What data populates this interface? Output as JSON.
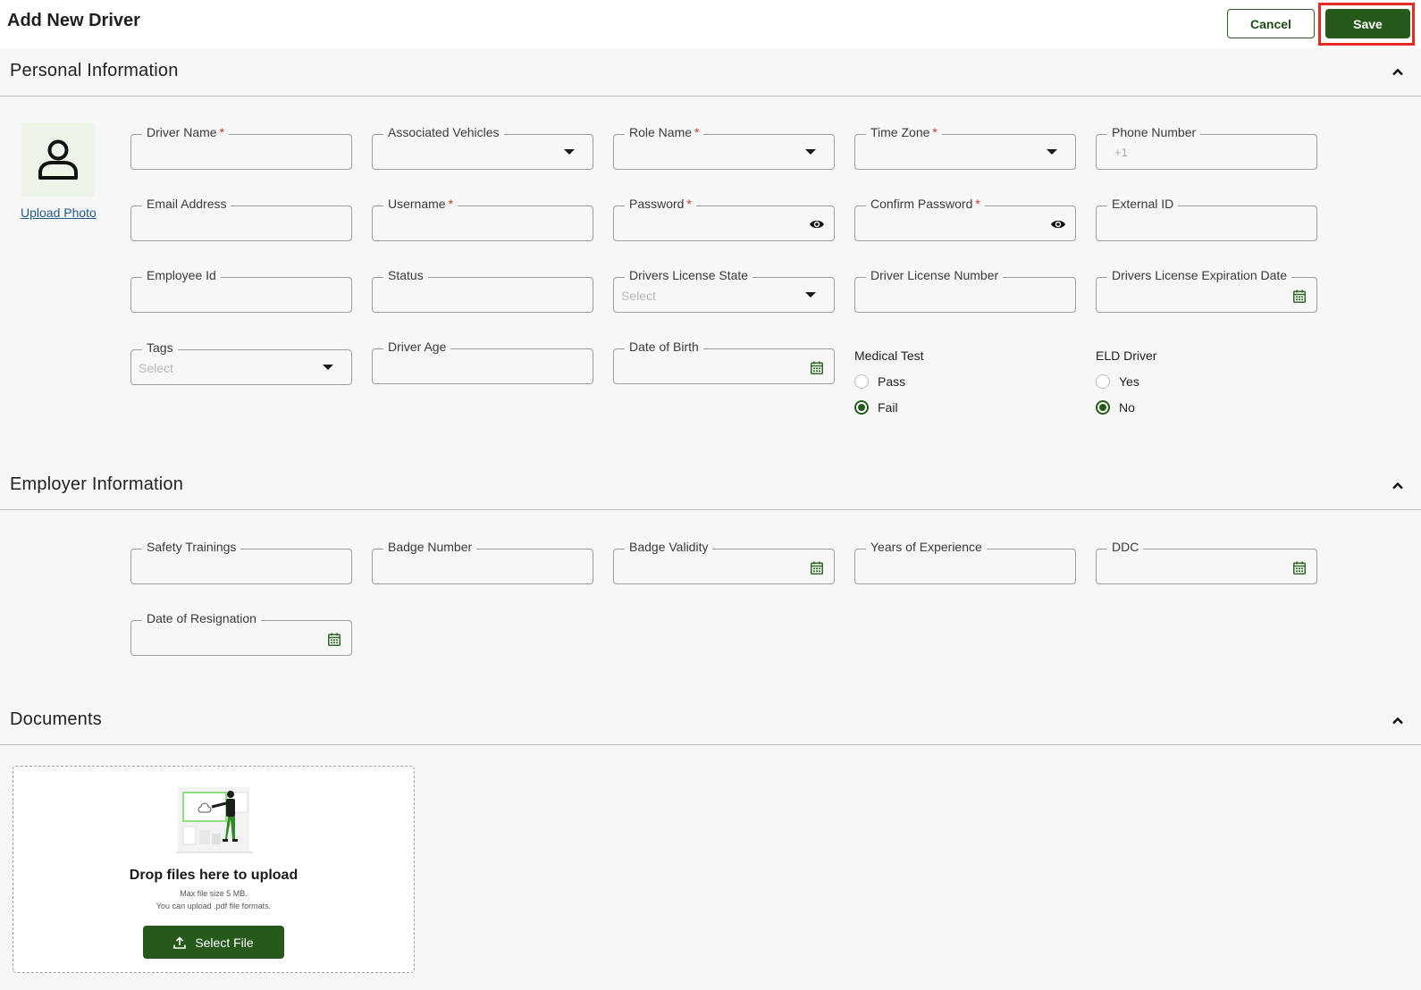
{
  "header": {
    "title": "Add New Driver",
    "cancel_label": "Cancel",
    "save_label": "Save"
  },
  "sections": {
    "personal": "Personal Information",
    "employer": "Employer Information",
    "documents": "Documents"
  },
  "photo": {
    "upload_label": "Upload Photo"
  },
  "personal_fields": {
    "driver_name": {
      "label": "Driver Name",
      "required": "*",
      "value": ""
    },
    "associated_vehicles": {
      "label": "Associated Vehicles",
      "value": ""
    },
    "role_name": {
      "label": "Role Name",
      "required": "*",
      "value": ""
    },
    "time_zone": {
      "label": "Time Zone",
      "required": "*",
      "value": ""
    },
    "phone_number": {
      "label": "Phone Number",
      "country_code": "+1",
      "value": ""
    },
    "email_address": {
      "label": "Email Address",
      "value": ""
    },
    "username": {
      "label": "Username",
      "required": "*",
      "value": ""
    },
    "password": {
      "label": "Password",
      "required": "*",
      "value": ""
    },
    "confirm_password": {
      "label": "Confirm Password",
      "required": "*",
      "value": ""
    },
    "external_id": {
      "label": "External ID",
      "value": ""
    },
    "employee_id": {
      "label": "Employee Id",
      "value": ""
    },
    "status": {
      "label": "Status",
      "value": ""
    },
    "drivers_license_state": {
      "label": "Drivers License State",
      "placeholder": "Select"
    },
    "driver_license_number": {
      "label": "Driver License Number",
      "value": ""
    },
    "drivers_license_expiration": {
      "label": "Drivers License Expiration Date",
      "value": ""
    },
    "tags": {
      "label": "Tags",
      "placeholder": "Select"
    },
    "driver_age": {
      "label": "Driver Age",
      "value": ""
    },
    "date_of_birth": {
      "label": "Date of Birth",
      "value": ""
    }
  },
  "medical_test": {
    "title": "Medical Test",
    "options": [
      "Pass",
      "Fail"
    ],
    "selected": "Fail"
  },
  "eld_driver": {
    "title": "ELD Driver",
    "options": [
      "Yes",
      "No"
    ],
    "selected": "No"
  },
  "employer_fields": {
    "safety_trainings": {
      "label": "Safety Trainings",
      "value": ""
    },
    "badge_number": {
      "label": "Badge Number",
      "value": ""
    },
    "badge_validity": {
      "label": "Badge Validity",
      "value": ""
    },
    "years_of_experience": {
      "label": "Years of Experience",
      "value": ""
    },
    "ddc": {
      "label": "DDC",
      "value": ""
    },
    "date_of_resignation": {
      "label": "Date of Resignation",
      "value": ""
    }
  },
  "documents": {
    "drop_title": "Drop files here to upload",
    "max_size": "Max file size 5 MB.",
    "formats": "You can upload .pdf file formats.",
    "select_label": "Select File"
  },
  "colors": {
    "primary": "#255a1a",
    "highlight": "#e52b22",
    "required": "#d32f2f",
    "link": "#1f5a8a"
  }
}
